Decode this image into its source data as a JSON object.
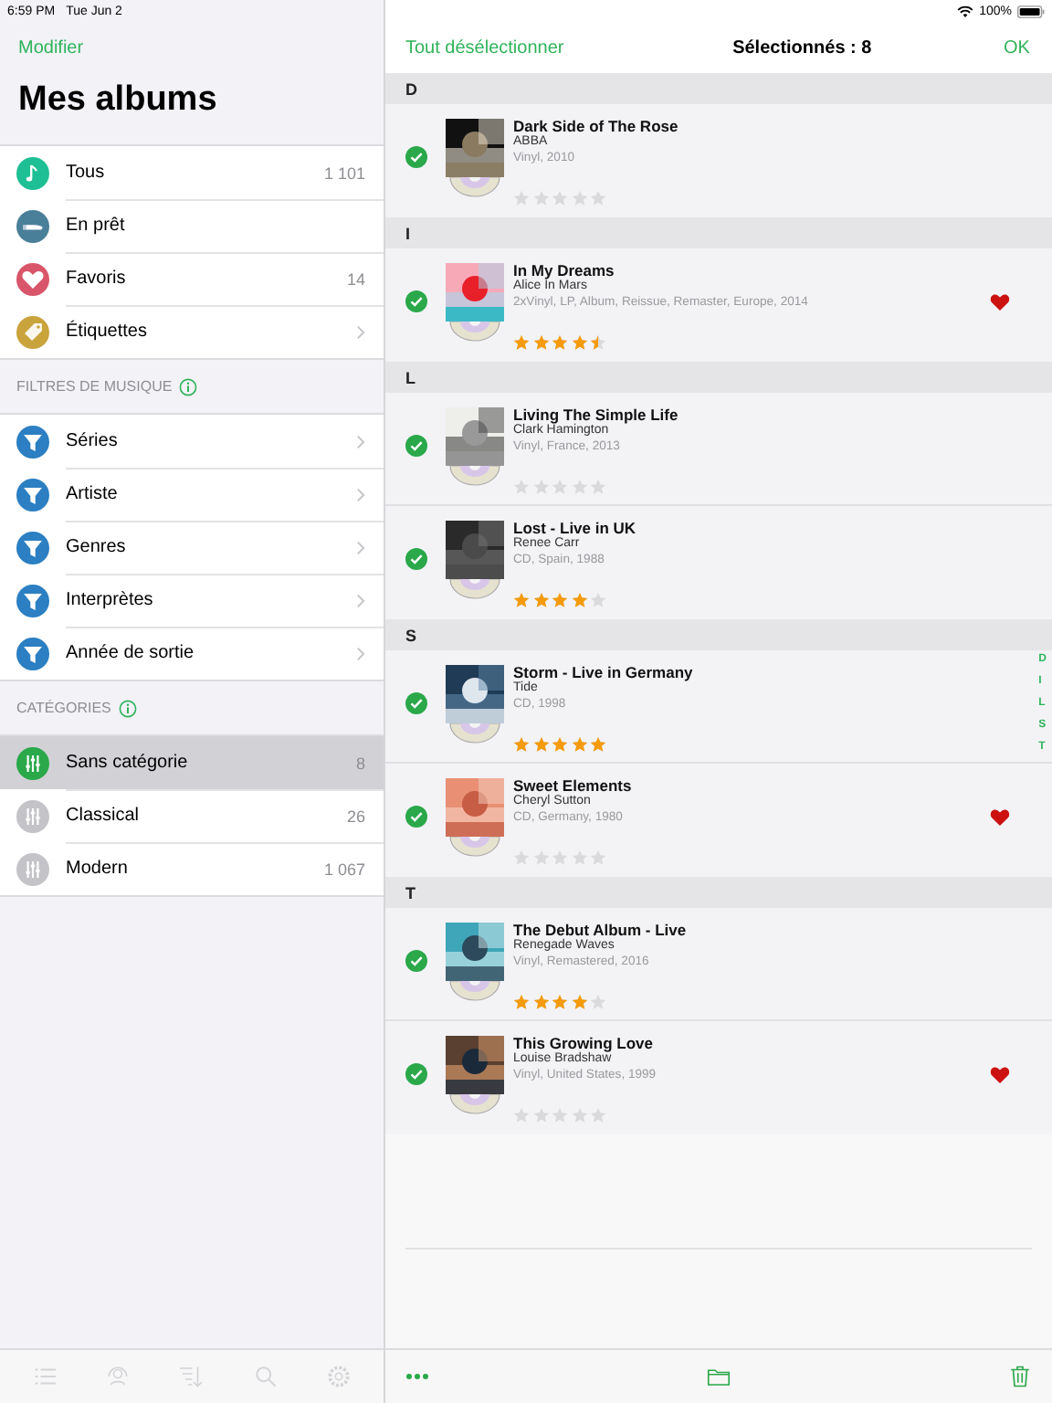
{
  "status_bar": {
    "time": "6:59 PM",
    "date": "Tue Jun 2",
    "battery": "100%"
  },
  "sidebar": {
    "edit_button": "Modifier",
    "title": "Mes albums",
    "sections": [
      {
        "items": [
          {
            "kind": "note",
            "color": "#1fbf95",
            "label": "Tous",
            "count": "1 101",
            "chevron": false,
            "selected": false
          },
          {
            "kind": "loan",
            "color": "#4a7f99",
            "label": "En prêt",
            "chevron": false,
            "selected": false
          },
          {
            "kind": "heart",
            "color": "#d9566a",
            "label": "Favoris",
            "count": "14",
            "chevron": false,
            "selected": false
          },
          {
            "kind": "tag",
            "color": "#c9a33c",
            "label": "Étiquettes",
            "chevron": true,
            "selected": false
          }
        ]
      },
      {
        "header": "FILTRES DE MUSIQUE",
        "info": true,
        "items": [
          {
            "kind": "filter",
            "color": "#2b7fc2",
            "label": "Séries",
            "chevron": true,
            "selected": false
          },
          {
            "kind": "filter",
            "color": "#2b7fc2",
            "label": "Artiste",
            "chevron": true,
            "selected": false
          },
          {
            "kind": "filter",
            "color": "#2b7fc2",
            "label": "Genres",
            "chevron": true,
            "selected": false
          },
          {
            "kind": "filter",
            "color": "#2b7fc2",
            "label": "Interprètes",
            "chevron": true,
            "selected": false
          },
          {
            "kind": "filter",
            "color": "#2b7fc2",
            "label": "Année de sortie",
            "chevron": true,
            "selected": false
          }
        ]
      },
      {
        "header": "CATÉGORIES",
        "info": true,
        "items": [
          {
            "kind": "category",
            "color": "#2aa84a",
            "label": "Sans catégorie",
            "count": "8",
            "chevron": false,
            "selected": true
          },
          {
            "kind": "category",
            "color": "#c4c4c8",
            "label": "Classical",
            "count": "26",
            "chevron": false,
            "selected": false
          },
          {
            "kind": "category",
            "color": "#c4c4c8",
            "label": "Modern",
            "count": "1 067",
            "chevron": false,
            "selected": false
          }
        ]
      }
    ],
    "toolbar": [
      {
        "kind": "list",
        "disabled": true
      },
      {
        "kind": "person",
        "disabled": true
      },
      {
        "kind": "sort",
        "disabled": true
      },
      {
        "kind": "search",
        "disabled": true
      },
      {
        "kind": "settings",
        "disabled": true
      }
    ]
  },
  "detail": {
    "deselect_button": "Tout désélectionner",
    "title": "Sélectionnés : 8",
    "ok_button": "OK",
    "sections": [
      {
        "letter": "D",
        "albums": [
          {
            "title": "Dark Side of The Rose",
            "artist": "ABBA",
            "details": "Vinyl, 2010",
            "stars": 0,
            "favorite": false,
            "selected": true
          }
        ]
      },
      {
        "letter": "I",
        "albums": [
          {
            "title": "In My Dreams",
            "artist": "Alice In Mars",
            "details": "2xVinyl, LP, Album, Reissue, Remaster, Europe, 2014",
            "stars": 4.5,
            "favorite": true,
            "selected": true
          }
        ]
      },
      {
        "letter": "L",
        "albums": [
          {
            "title": "Living The Simple Life",
            "artist": "Clark Hamington",
            "details": "Vinyl, France, 2013",
            "stars": 0,
            "favorite": false,
            "selected": true
          },
          {
            "title": "Lost - Live in UK",
            "artist": "Renee Carr",
            "details": "CD, Spain, 1988",
            "stars": 4,
            "favorite": false,
            "selected": true
          }
        ]
      },
      {
        "letter": "S",
        "albums": [
          {
            "title": "Storm - Live in Germany",
            "artist": "Tide",
            "details": "CD, 1998",
            "stars": 5,
            "favorite": false,
            "selected": true
          },
          {
            "title": "Sweet Elements",
            "artist": "Cheryl Sutton",
            "details": "CD, Germany, 1980",
            "stars": 0,
            "favorite": true,
            "selected": true
          }
        ]
      },
      {
        "letter": "T",
        "albums": [
          {
            "title": "The Debut Album - Live",
            "artist": "Renegade Waves",
            "details": "Vinyl, Remastered, 2016",
            "stars": 4,
            "favorite": false,
            "selected": true
          },
          {
            "title": "This Growing Love",
            "artist": "Louise Bradshaw",
            "details": "Vinyl, United States, 1999",
            "stars": 0,
            "favorite": true,
            "selected": true
          }
        ]
      }
    ],
    "index": [
      "D",
      "I",
      "L",
      "S",
      "T"
    ],
    "toolbar": [
      {
        "kind": "more",
        "disabled": false
      },
      {
        "kind": "folder",
        "disabled": false
      },
      {
        "kind": "trash",
        "disabled": false
      }
    ]
  }
}
